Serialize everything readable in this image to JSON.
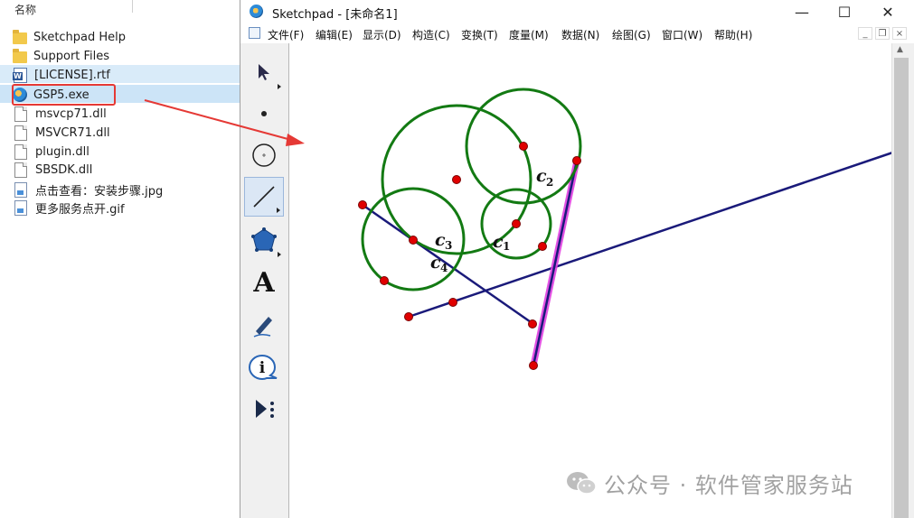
{
  "explorer": {
    "column_header": "名称",
    "files": [
      {
        "name": "Sketchpad Help",
        "icon": "folder-icon"
      },
      {
        "name": "Support Files",
        "icon": "folder-icon"
      },
      {
        "name": "[LICENSE].rtf",
        "icon": "rtf-file-icon"
      },
      {
        "name": "GSP5.exe",
        "icon": "exe-icon"
      },
      {
        "name": "msvcp71.dll",
        "icon": "dll-file-icon"
      },
      {
        "name": "MSVCR71.dll",
        "icon": "dll-file-icon"
      },
      {
        "name": "plugin.dll",
        "icon": "dll-file-icon"
      },
      {
        "name": "SBSDK.dll",
        "icon": "dll-file-icon"
      },
      {
        "name": "点击查看：安装步骤.jpg",
        "icon": "image-file-icon"
      },
      {
        "name": "更多服务点开.gif",
        "icon": "image-file-icon"
      }
    ],
    "highlight_color": "#e53935"
  },
  "window": {
    "app_name": "Sketchpad",
    "title": "Sketchpad  - [未命名1]",
    "controls": {
      "minimize": "—",
      "maximize": "☐",
      "close": "✕"
    },
    "menu": [
      "文件(F)",
      "编辑(E)",
      "显示(D)",
      "构造(C)",
      "变换(T)",
      "度量(M)",
      "数据(N)",
      "绘图(G)",
      "窗口(W)",
      "帮助(H)"
    ],
    "mdi_controls": {
      "minimize": "_",
      "restore": "❐",
      "close": "×"
    }
  },
  "toolbox": {
    "tools": [
      {
        "name": "arrow-tool",
        "icon": "arrow-icon"
      },
      {
        "name": "point-tool",
        "icon": "point-icon"
      },
      {
        "name": "compass-tool",
        "icon": "circle-icon"
      },
      {
        "name": "straightedge-tool",
        "icon": "segment-icon",
        "active": true
      },
      {
        "name": "polygon-tool",
        "icon": "polygon-icon"
      },
      {
        "name": "text-tool",
        "icon": "text-a-icon",
        "glyph": "A"
      },
      {
        "name": "marker-tool",
        "icon": "marker-icon"
      },
      {
        "name": "information-tool",
        "icon": "info-icon",
        "glyph": "i"
      },
      {
        "name": "custom-tool",
        "icon": "custom-tools-icon"
      }
    ]
  },
  "sketch": {
    "circle_labels": [
      {
        "letter": "c",
        "sub": "1"
      },
      {
        "letter": "c",
        "sub": "2"
      },
      {
        "letter": "c",
        "sub": "3"
      },
      {
        "letter": "c",
        "sub": "4"
      }
    ],
    "colors": {
      "circles": "#137a13",
      "lines": "#1a1a7a",
      "points": "#e00000",
      "selection": "#e040e0"
    }
  },
  "watermark": {
    "text": "公众号 · 软件管家服务站",
    "icon": "wechat-icon"
  }
}
